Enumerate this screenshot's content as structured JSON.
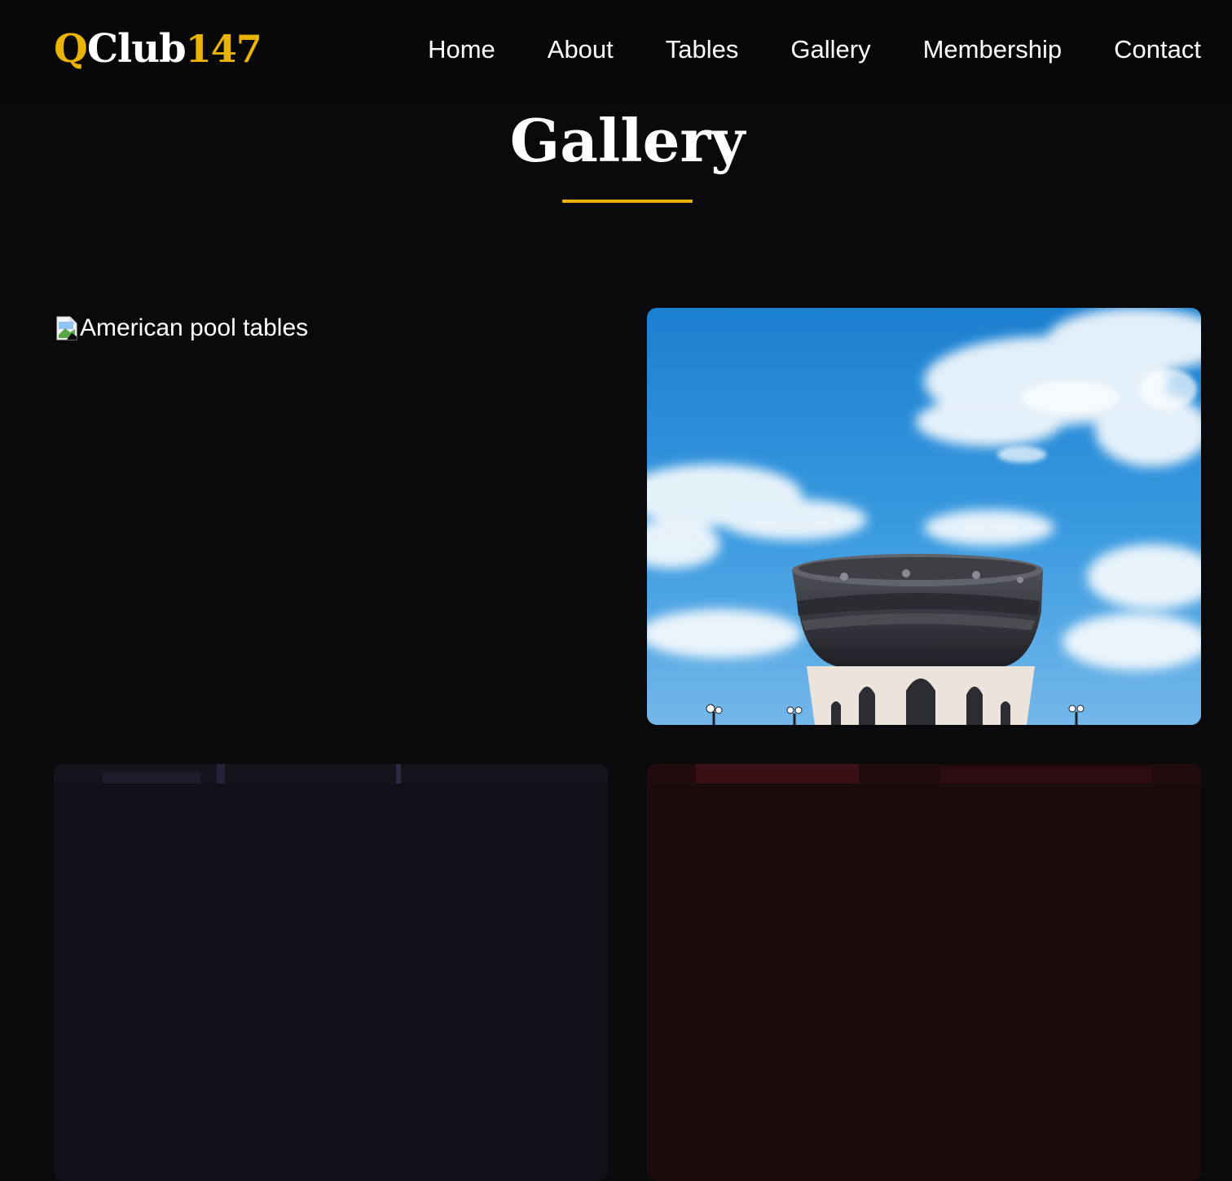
{
  "brand": {
    "q": "Q",
    "club": "Club",
    "num": "147"
  },
  "nav": {
    "items": [
      {
        "label": "Home"
      },
      {
        "label": "About"
      },
      {
        "label": "Tables"
      },
      {
        "label": "Gallery"
      },
      {
        "label": "Membership"
      },
      {
        "label": "Contact"
      }
    ]
  },
  "page": {
    "title": "Gallery"
  },
  "gallery": {
    "items": [
      {
        "alt": "American pool tables",
        "image": "broken-image-icon"
      },
      {
        "image": "building-sky-photo"
      },
      {
        "image": "dark-hall-photo"
      },
      {
        "image": "red-interior-photo"
      }
    ]
  },
  "colors": {
    "accent": "#eab308",
    "background": "#0a0a0d",
    "nav_bg": "#08080a",
    "text": "#ffffff"
  }
}
